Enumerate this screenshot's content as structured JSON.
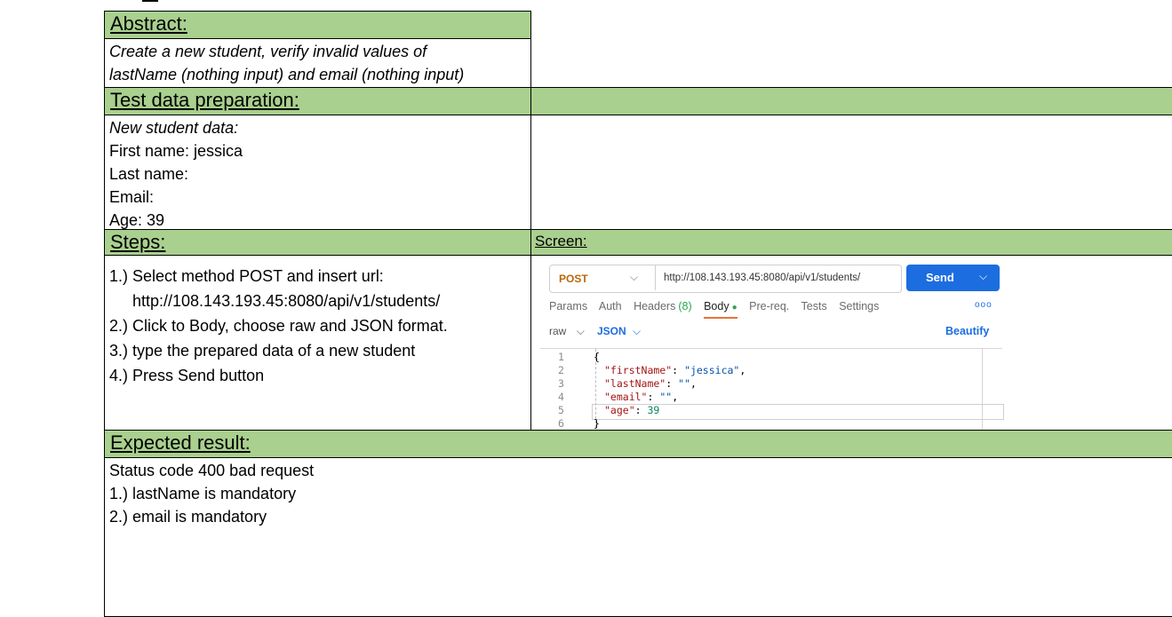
{
  "abstract": {
    "header": "Abstract:",
    "lines": [
      "Create a new student, verify invalid  values of",
      "lastName (nothing input) and email (nothing input)"
    ]
  },
  "test_data": {
    "header": "Test data preparation:",
    "lines": [
      "New student data:",
      "First name: jessica",
      "Last name:",
      "Email:",
      "Age: 39"
    ]
  },
  "steps": {
    "header": "Steps:",
    "lines": [
      "1.) Select method POST and insert url:",
      "http://108.143.193.45:8080/api/v1/students/",
      "2.) Click to Body, choose raw and JSON format.",
      "3.) type the prepared data of a new student",
      "4.) Press Send button"
    ]
  },
  "screen": {
    "header": "Screen:",
    "method": "POST",
    "url": "http://108.143.193.45:8080/api/v1/students/",
    "send_label": "Send",
    "tabs": {
      "params": "Params",
      "auth": "Auth",
      "headers": "Headers",
      "headers_count": "(8)",
      "body": "Body",
      "prereq": "Pre-req.",
      "tests": "Tests",
      "settings": "Settings"
    },
    "body_mode": "raw",
    "format": "JSON",
    "beautify_label": "Beautify",
    "code": {
      "line_numbers": [
        "1",
        "2",
        "3",
        "4",
        "5",
        "6"
      ],
      "open_brace": "{",
      "close_brace": "}",
      "key1": "\"firstName\"",
      "val1": "\"jessica\"",
      "key2": "\"lastName\"",
      "val2": "\"\"",
      "key3": "\"email\"",
      "val3": "\"\"",
      "key4": "\"age\"",
      "val4": "39"
    },
    "accent_colors": {
      "send_button": "#1c6de0",
      "method": "#b8680c",
      "body_tab_underline": "#e8723a"
    }
  },
  "expected": {
    "header": "Expected result:",
    "lines": [
      "Status code 400 bad request",
      "1.) lastName is mandatory",
      "2.) email is mandatory"
    ]
  },
  "colors": {
    "header_green": "#a9d08e"
  }
}
